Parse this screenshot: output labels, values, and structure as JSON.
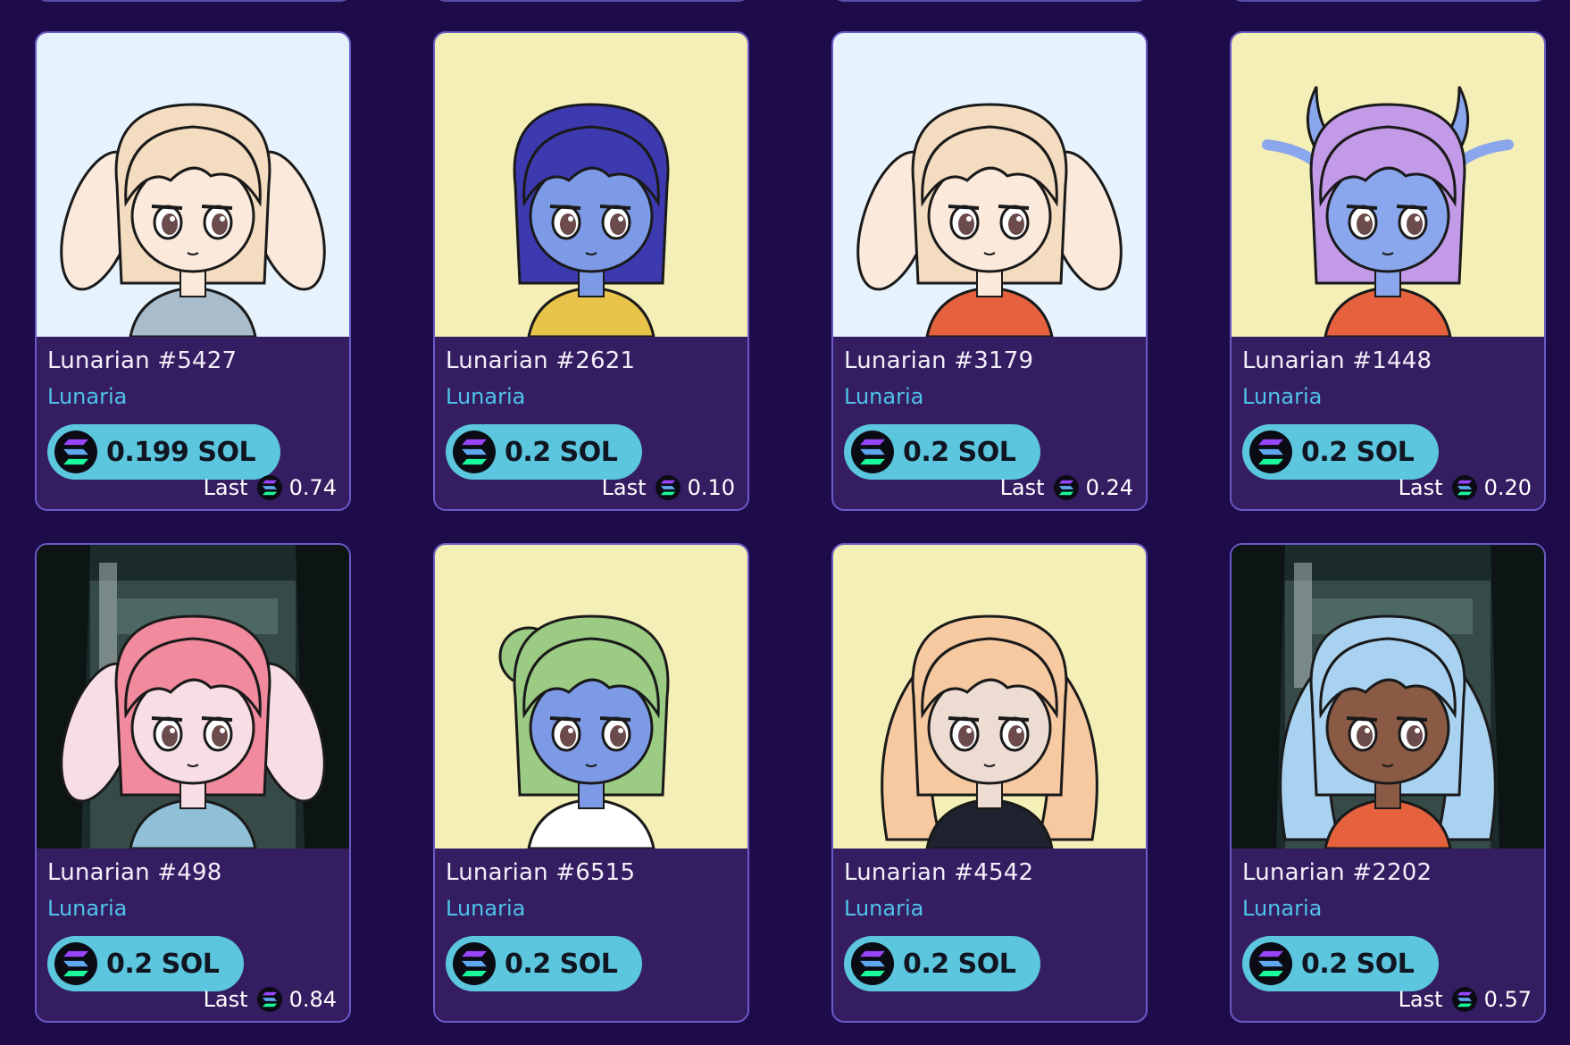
{
  "currency_symbol_icon": "solana-icon",
  "colors": {
    "background": "#1d0b4a",
    "card": "#351d62",
    "card_border": "#6a5ac6",
    "collection_link": "#4fc3e8",
    "price_pill": "#5bc6dd"
  },
  "cards": [
    {
      "name": "Lunarian #5427",
      "collection": "Lunaria",
      "price": "0.199 SOL",
      "last_label": "Last",
      "last_value": "0.74",
      "bg": "#e6f3fc",
      "hair": "#f4dcc0",
      "skin": "#fbe9dc",
      "ears": "bunny",
      "outfit": "#a8bccb"
    },
    {
      "name": "Lunarian #2621",
      "collection": "Lunaria",
      "price": "0.2 SOL",
      "last_label": "Last",
      "last_value": "0.10",
      "bg": "#f4efb6",
      "hair": "#3d3ab0",
      "skin": "#7d9ae6",
      "ears": "none",
      "outfit": "#e8c44a"
    },
    {
      "name": "Lunarian #3179",
      "collection": "Lunaria",
      "price": "0.2 SOL",
      "last_label": "Last",
      "last_value": "0.24",
      "bg": "#e6f3fc",
      "hair": "#f4dcc0",
      "skin": "#fbe9dc",
      "ears": "bunny",
      "outfit": "#e6623f"
    },
    {
      "name": "Lunarian #1448",
      "collection": "Lunaria",
      "price": "0.2 SOL",
      "last_label": "Last",
      "last_value": "0.20",
      "bg": "#f4efb6",
      "hair": "#c39ae8",
      "skin": "#8aa6ec",
      "ears": "horns",
      "outfit": "#e6623f"
    },
    {
      "name": "Lunarian #498",
      "collection": "Lunaria",
      "price": "0.2 SOL",
      "last_label": "Last",
      "last_value": "0.84",
      "bg": "#1b2a2a",
      "hair": "#f08a9c",
      "skin": "#f7dde4",
      "ears": "bunny",
      "outfit": "#8fc0d8"
    },
    {
      "name": "Lunarian #6515",
      "collection": "Lunaria",
      "price": "0.2 SOL",
      "last_label": "",
      "last_value": "",
      "bg": "#f4efb6",
      "hair": "#9ccc84",
      "skin": "#7d9ae6",
      "ears": "bun",
      "outfit": "#ffffff"
    },
    {
      "name": "Lunarian #4542",
      "collection": "Lunaria",
      "price": "0.2 SOL",
      "last_label": "",
      "last_value": "",
      "bg": "#f4efb6",
      "hair": "#f6c9a0",
      "skin": "#eddcd2",
      "ears": "twintails",
      "outfit": "#1f2330"
    },
    {
      "name": "Lunarian #2202",
      "collection": "Lunaria",
      "price": "0.2 SOL",
      "last_label": "Last",
      "last_value": "0.57",
      "bg": "#1b2a2a",
      "hair": "#a9d2f0",
      "skin": "#8a5a45",
      "ears": "twintails",
      "outfit": "#e6623f"
    }
  ]
}
